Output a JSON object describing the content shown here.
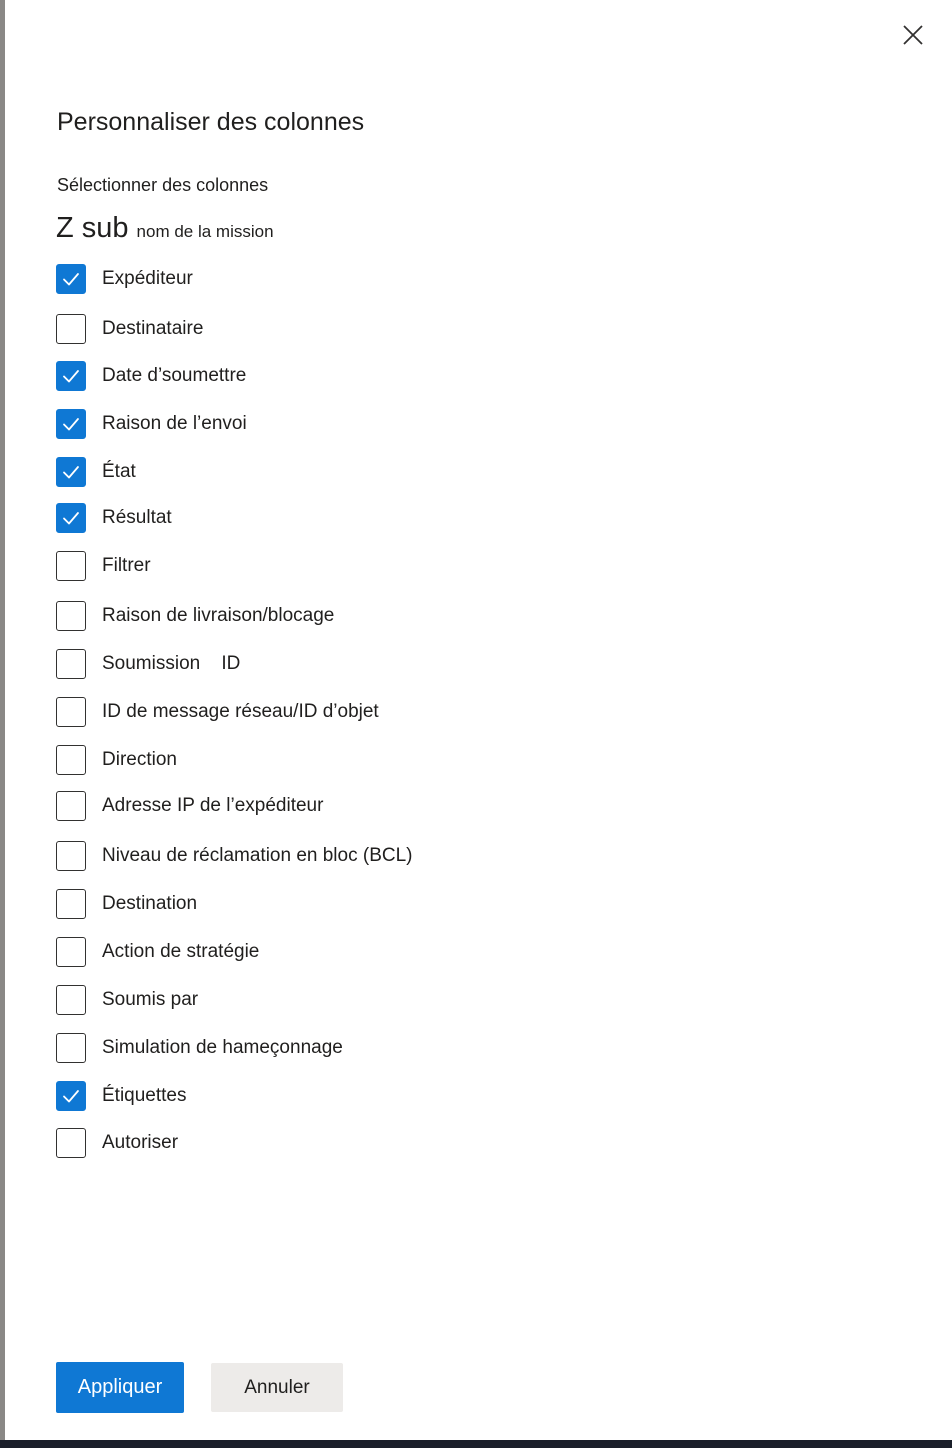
{
  "panel": {
    "title": "Personnaliser des colonnes",
    "subtitle": "Sélectionner des colonnes",
    "zsub_big": "Z sub",
    "zsub_small": "nom de la mission",
    "close_icon": "close-icon"
  },
  "columns": [
    {
      "label": "Expéditeur",
      "checked": true
    },
    {
      "label": "Destinataire",
      "checked": false
    },
    {
      "label": "Date d’soumettre",
      "checked": true
    },
    {
      "label": "Raison de l’envoi",
      "checked": true
    },
    {
      "label": "État",
      "checked": true
    },
    {
      "label": "Résultat",
      "checked": true
    },
    {
      "label": "Filtrer",
      "checked": false
    },
    {
      "label": "Raison de livraison/blocage",
      "checked": false
    },
    {
      "label": "Soumission    ID",
      "checked": false
    },
    {
      "label": "ID de message réseau/ID d’objet",
      "checked": false
    },
    {
      "label": "Direction",
      "checked": false
    },
    {
      "label": "Adresse IP de l’expéditeur",
      "checked": false
    },
    {
      "label": "Niveau de réclamation en bloc (BCL)",
      "checked": false
    },
    {
      "label": "Destination",
      "checked": false
    },
    {
      "label": "Action de stratégie",
      "checked": false
    },
    {
      "label": "Soumis par",
      "checked": false
    },
    {
      "label": "Simulation de hameçonnage",
      "checked": false
    },
    {
      "label": "Étiquettes",
      "checked": true
    },
    {
      "label": "Autoriser",
      "checked": false
    }
  ],
  "footer": {
    "apply_label": "Appliquer",
    "cancel_label": "Annuler"
  },
  "colors": {
    "accent": "#0f78d4",
    "secondary_button": "#edebe9",
    "text": "#201f1e"
  }
}
